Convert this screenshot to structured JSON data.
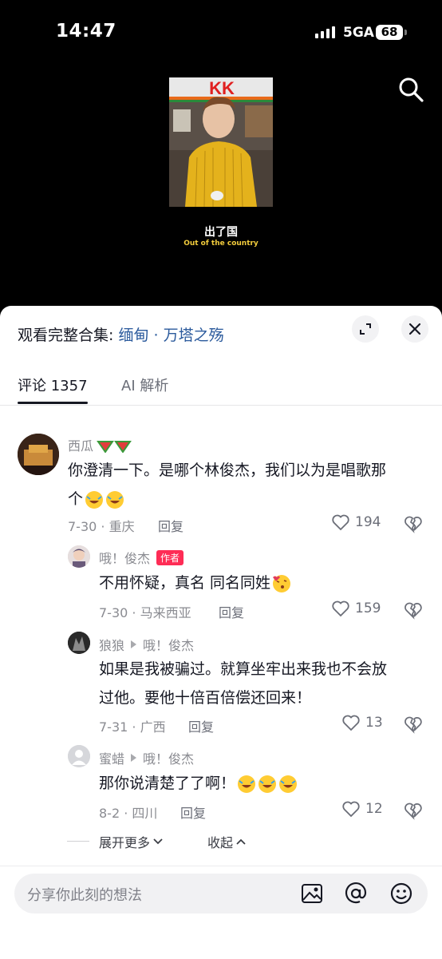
{
  "status_bar": {
    "time": "14:47",
    "network": "5GA",
    "battery": "68"
  },
  "video": {
    "caption_cn": "出了国",
    "caption_en": "Out of the country",
    "sign_text": "KK"
  },
  "sheet": {
    "collection_prefix": "观看完整合集:",
    "collection_link": "缅甸 · 万塔之殇",
    "tabs": [
      {
        "label": "评论 1357"
      },
      {
        "label": "AI 解析"
      }
    ]
  },
  "comments": [
    {
      "user": "西瓜",
      "text_line1": "你澄清一下。是哪个林俊杰，我们以为是唱歌那",
      "text_line2": "个",
      "date_loc": "7-30 · 重庆",
      "reply": "回复",
      "likes": "194"
    },
    {
      "user": "哦！俊杰",
      "badge": "作者",
      "text": "不用怀疑，真名 同名同姓",
      "date_loc": "7-30 · 马来西亚",
      "reply": "回复",
      "likes": "159"
    },
    {
      "user": "狼狼",
      "reply_to": "哦！俊杰",
      "text_line1": "如果是我被骗过。就算坐牢出来我也不会放",
      "text_line2": "过他。要他十倍百倍偿还回来！",
      "date_loc": "7-31 · 广西",
      "reply": "回复",
      "likes": "13"
    },
    {
      "user": "蜜蜡",
      "reply_to": "哦！俊杰",
      "text": "那你说清楚了了啊！",
      "date_loc": "8-2 · 四川",
      "reply": "回复",
      "likes": "12"
    }
  ],
  "thread": {
    "expand_more": "展开更多",
    "collapse": "收起"
  },
  "input": {
    "placeholder": "分享你此刻的想法"
  }
}
